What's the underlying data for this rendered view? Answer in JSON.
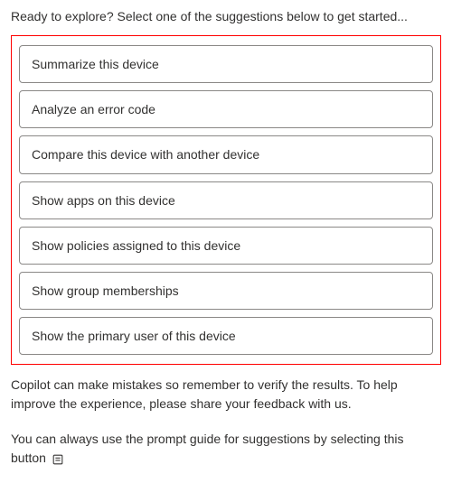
{
  "intro": "Ready to explore? Select one of the suggestions below to get started...",
  "suggestions": {
    "items": [
      {
        "label": "Summarize this device"
      },
      {
        "label": "Analyze an error code"
      },
      {
        "label": "Compare this device with another device"
      },
      {
        "label": "Show apps on this device"
      },
      {
        "label": "Show policies assigned to this device"
      },
      {
        "label": "Show group memberships"
      },
      {
        "label": "Show the primary user of this device"
      }
    ]
  },
  "disclaimer": "Copilot can make mistakes so remember to verify the results. To help improve the experience, please share your feedback with us.",
  "hint": "You can always use the prompt guide for suggestions by selecting this button"
}
